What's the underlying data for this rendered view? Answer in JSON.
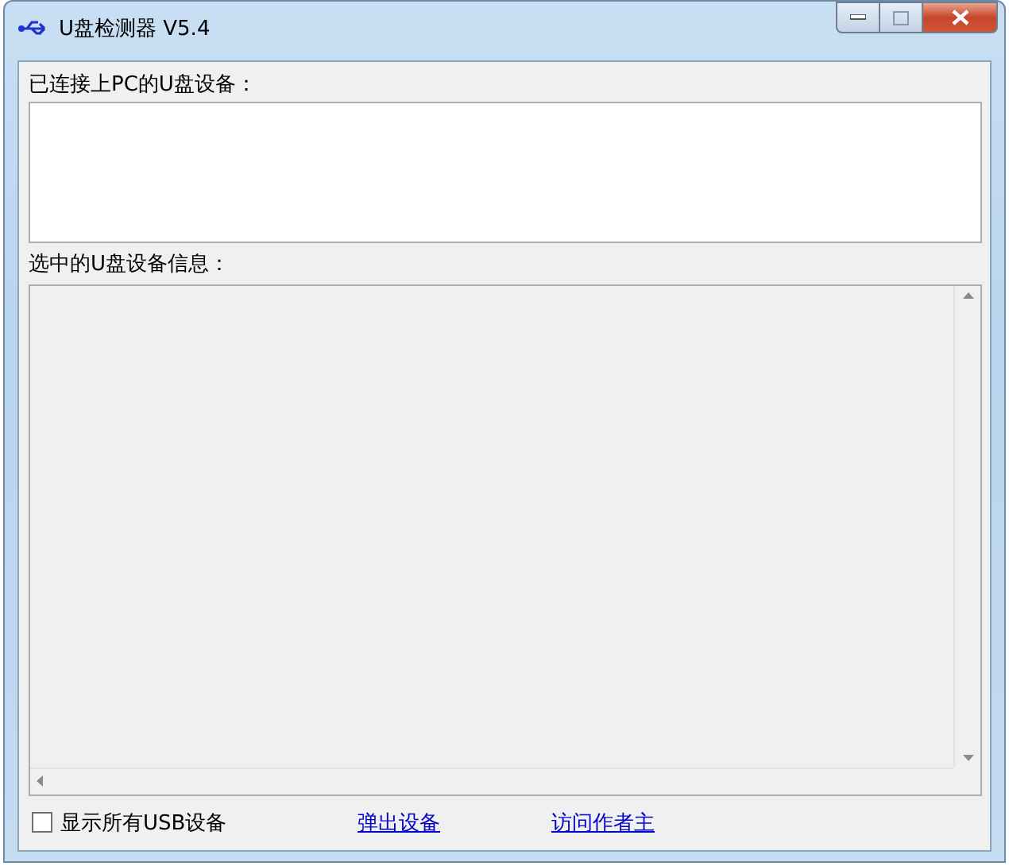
{
  "window": {
    "title": "U盘检测器 V5.4"
  },
  "device_list": {
    "label": "已连接上PC的U盘设备："
  },
  "info": {
    "label": "选中的U盘设备信息："
  },
  "footer": {
    "show_all": {
      "label": "显示所有USB设备",
      "checked": false
    },
    "links": [
      "弹出设备",
      "访问作者主"
    ]
  }
}
